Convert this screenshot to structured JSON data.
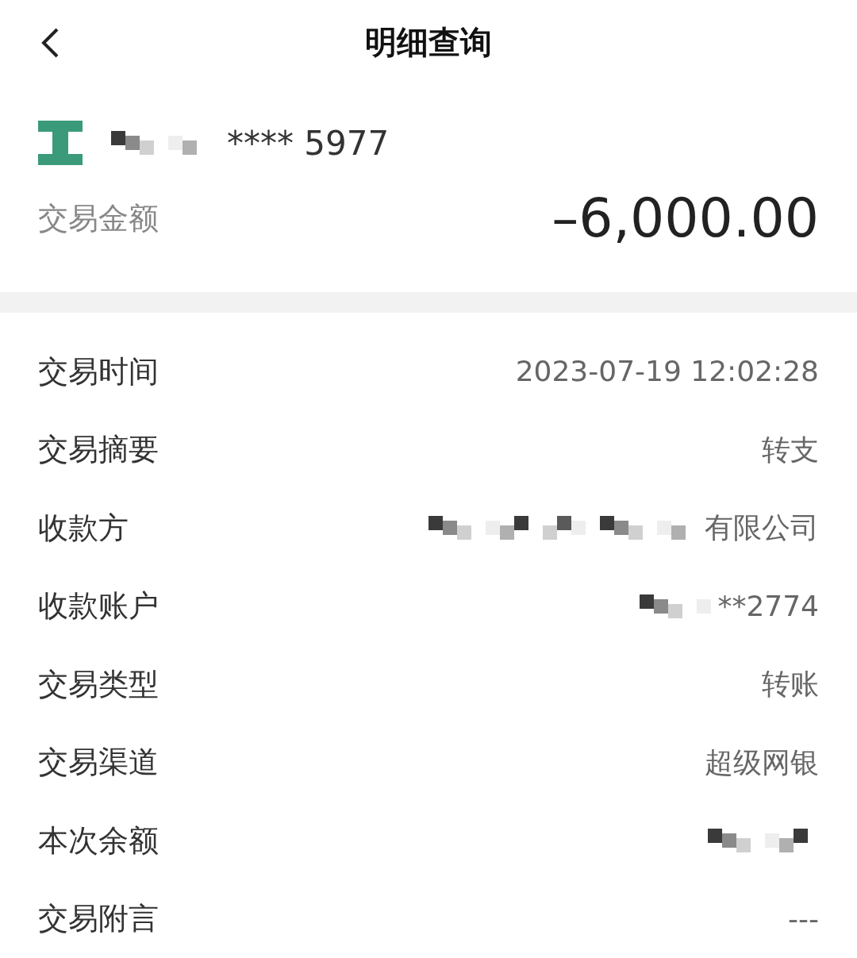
{
  "header": {
    "title": "明细查询"
  },
  "account": {
    "number": "**** 5977",
    "redacted": true
  },
  "amount": {
    "label": "交易金额",
    "value": "–6,000.00"
  },
  "rows": [
    {
      "label": "交易时间",
      "value": "2023-07-19 12:02:28",
      "redacted": false
    },
    {
      "label": "交易摘要",
      "value": "转支",
      "redacted": false
    },
    {
      "label": "收款方",
      "value": "有限公司",
      "redacted": true
    },
    {
      "label": "收款账户",
      "value": "**2774",
      "redacted": true
    },
    {
      "label": "交易类型",
      "value": "转账",
      "redacted": false
    },
    {
      "label": "交易渠道",
      "value": "超级网银",
      "redacted": false
    },
    {
      "label": "本次余额",
      "redacted": true
    },
    {
      "label": "交易附言",
      "value": "---",
      "redacted": false
    }
  ]
}
